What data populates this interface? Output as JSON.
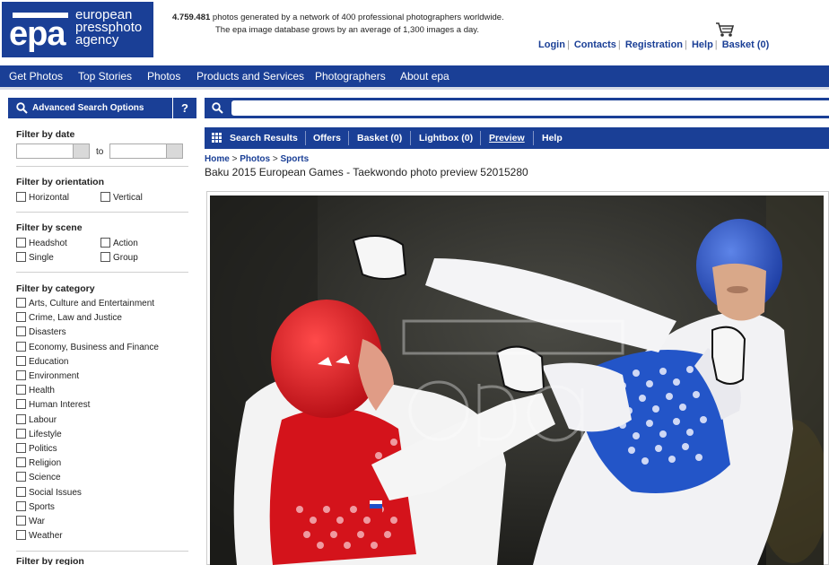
{
  "logo": {
    "mark": "epa",
    "tagline": "european pressphoto agency"
  },
  "stats": {
    "count": "4.759.481",
    "line1_rest": " photos generated by a network of 400 professional photographers worldwide.",
    "line2": "The epa image database grows by an average of 1,300 images a day."
  },
  "toplinks": [
    "Login",
    "Contacts",
    "Registration",
    "Help",
    "Basket (0)"
  ],
  "nav": [
    "Get Photos",
    "Top Stories",
    "Photos",
    "Products and Services",
    "Photographers",
    "About epa"
  ],
  "advanced_search": {
    "label": "Advanced Search Options",
    "help": "?"
  },
  "filters": {
    "date": {
      "title": "Filter by date",
      "to": "to"
    },
    "orientation": {
      "title": "Filter by orientation",
      "options": [
        "Horizontal",
        "Vertical"
      ]
    },
    "scene": {
      "title": "Filter by scene",
      "options": [
        "Headshot",
        "Action",
        "Single",
        "Group"
      ]
    },
    "category": {
      "title": "Filter by category",
      "options": [
        "Arts, Culture and Entertainment",
        "Crime, Law and Justice",
        "Disasters",
        "Economy, Business and Finance",
        "Education",
        "Environment",
        "Health",
        "Human Interest",
        "Labour",
        "Lifestyle",
        "Politics",
        "Religion",
        "Science",
        "Social Issues",
        "Sports",
        "War",
        "Weather"
      ]
    },
    "region": {
      "title": "Filter by region"
    }
  },
  "search": {
    "placeholder": ""
  },
  "toolbar": [
    "Search Results",
    "Offers",
    "Basket (0)",
    "Lightbox (0)",
    "Preview",
    "Help"
  ],
  "breadcrumb": {
    "home": "Home",
    "photos": "Photos",
    "sports": "Sports"
  },
  "page_title": "Baku 2015 European Games - Taekwondo photo preview 52015280",
  "photo_watermark": "epa",
  "colors": {
    "brand": "#1a3f96",
    "red_gear": "#d4131b",
    "blue_gear": "#1f4fc7"
  }
}
